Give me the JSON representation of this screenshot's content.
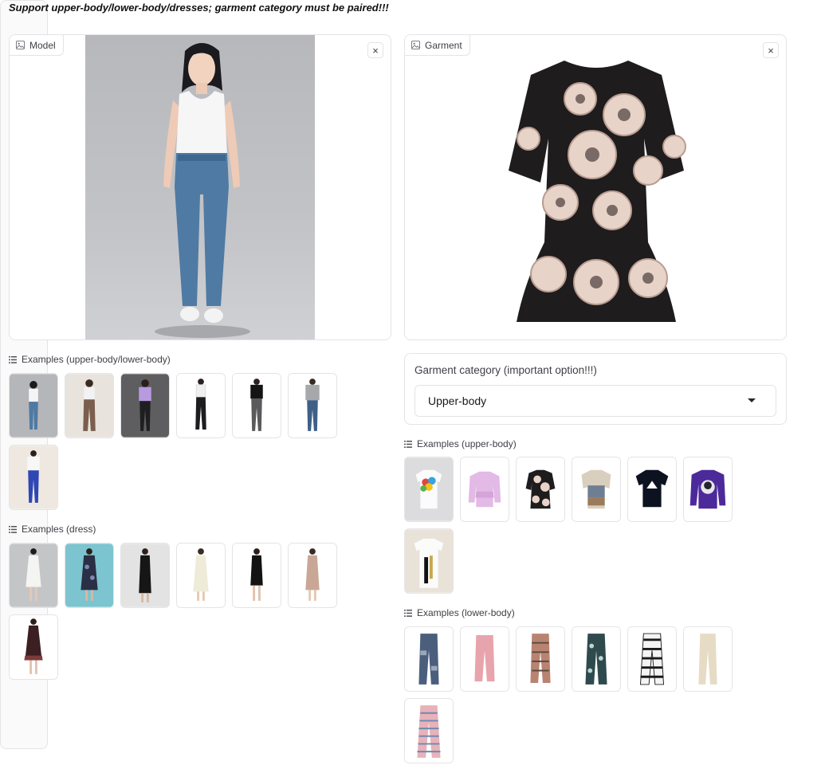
{
  "notice": "Support upper-body/lower-body/dresses; garment category must be paired!!!",
  "model_panel": {
    "label": "Model",
    "close_glyph": "×"
  },
  "garment_panel": {
    "label": "Garment",
    "close_glyph": "×"
  },
  "examples_model": {
    "label": "Examples (upper-body/lower-body)",
    "count": 7
  },
  "examples_dress": {
    "label": "Examples (dress)",
    "count": 7
  },
  "garment_category": {
    "title": "Garment category (important option!!!)",
    "value": "Upper-body"
  },
  "examples_upper": {
    "label": "Examples (upper-body)",
    "count": 7
  },
  "examples_lower": {
    "label": "Examples (lower-body)",
    "count": 7
  },
  "icons": {
    "image": "image-icon",
    "close": "close-icon",
    "list": "list-icon",
    "caret": "caret-down-icon"
  },
  "colors": {
    "border": "#e4e4e7",
    "text": "#3f3f46",
    "background": "#ffffff"
  }
}
